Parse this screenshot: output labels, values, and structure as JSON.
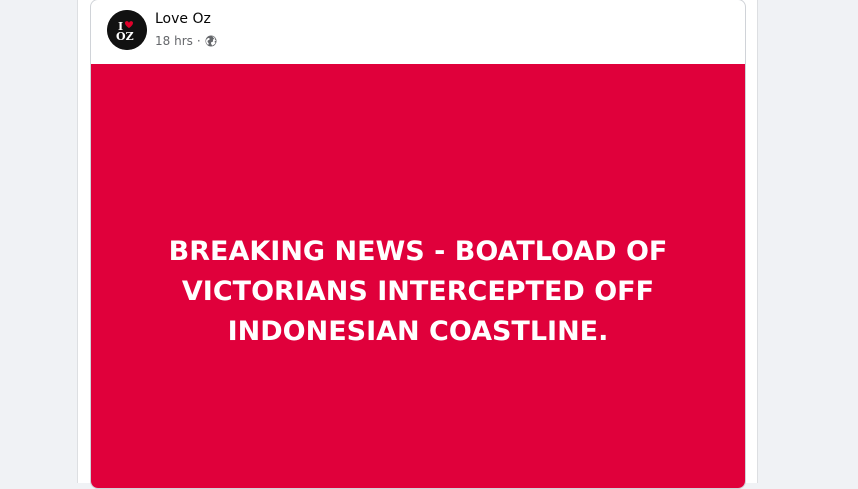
{
  "post": {
    "page_name": "Love Oz",
    "timestamp": "18 hrs",
    "separator": "·",
    "privacy_icon": "globe-icon",
    "avatar": {
      "letter_top": "I",
      "letters_bottom": "OZ",
      "heart_color": "#e0002a"
    },
    "image": {
      "background_color": "#e0003b",
      "headline_lines": [
        "BREAKING NEWS - BOATLOAD OF",
        "VICTORIANS INTERCEPTED OFF",
        "INDONESIAN COASTLINE."
      ]
    }
  }
}
